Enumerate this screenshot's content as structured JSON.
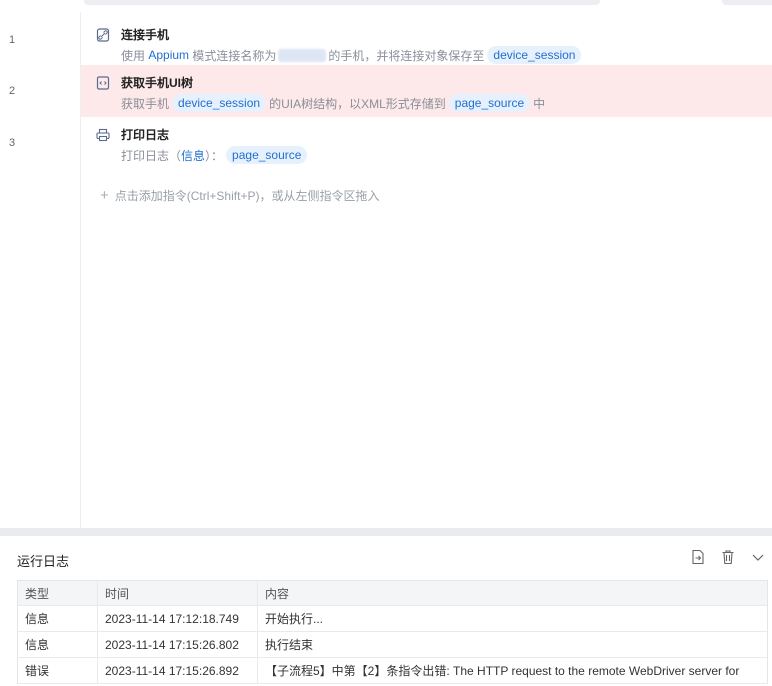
{
  "editor": {
    "line_numbers": [
      "1",
      "2",
      "3"
    ],
    "steps": [
      {
        "title": "连接手机",
        "icon": "link-icon",
        "desc_prefix": "使用",
        "desc_tool": "Appium",
        "desc_mid": "模式连接名称为",
        "desc_mid2": "的手机，并将连接对象保存至",
        "desc_var": "device_session"
      },
      {
        "title": "获取手机UI树",
        "icon": "code-file-icon",
        "desc_prefix": "获取手机",
        "desc_var1": "device_session",
        "desc_mid": "的UIA树结构，以XML形式存储到",
        "desc_var2": "page_source",
        "desc_suffix": "中"
      },
      {
        "title": "打印日志",
        "icon": "printer-icon",
        "desc_prefix": "打印日志（",
        "desc_level": "信息",
        "desc_mid": "）：",
        "desc_var": "page_source"
      }
    ],
    "add_hint": "点击添加指令(Ctrl+Shift+P)，或从左侧指令区拖入"
  },
  "log": {
    "title": "运行日志",
    "tools": [
      "export-icon",
      "trash-icon",
      "chevron-down-icon"
    ],
    "columns": [
      "类型",
      "时间",
      "内容"
    ],
    "rows": [
      {
        "type": "信息",
        "time": "2023-11-14 17:12:18.749",
        "content": "开始执行..."
      },
      {
        "type": "信息",
        "time": "2023-11-14 17:15:26.802",
        "content": "执行结束"
      },
      {
        "type": "错误",
        "time": "2023-11-14 17:15:26.892",
        "content": "【子流程5】中第【2】条指令出错: The HTTP request to the remote WebDriver server for"
      }
    ]
  },
  "colors": {
    "accent": "#1f6fd1",
    "error_row_bg": "#fde9e9",
    "variable_chip_bg": "#e7f1fe"
  }
}
